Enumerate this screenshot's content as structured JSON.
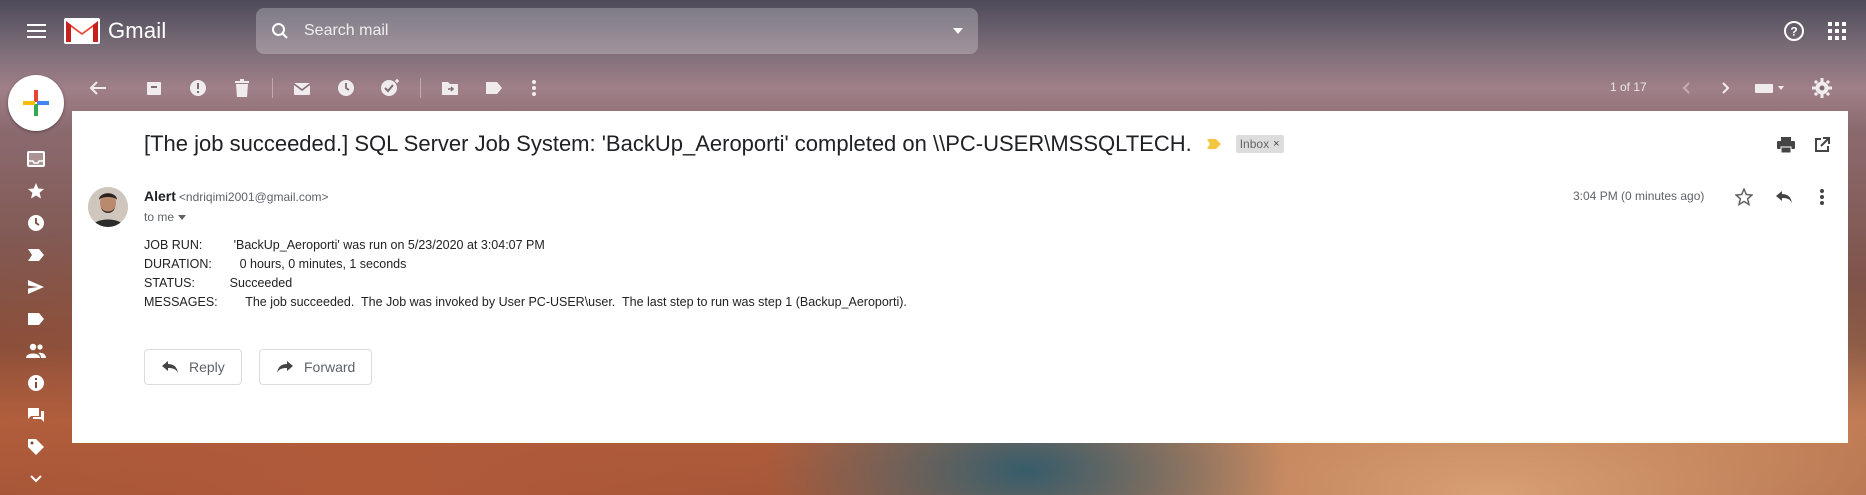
{
  "app": {
    "name": "Gmail"
  },
  "search": {
    "placeholder": "Search mail"
  },
  "toolbar": {
    "pager": "1 of 17"
  },
  "email": {
    "subject": "[The job succeeded.] SQL Server Job System: 'BackUp_Aeroporti' completed on \\\\PC-USER\\MSSQLTECH.",
    "label": "Inbox",
    "label_remove": "×",
    "sender_name": "Alert",
    "sender_email": "<ndriqimi2001@gmail.com>",
    "to": "to me",
    "time": "3:04 PM (0 minutes ago)",
    "body": [
      "JOB RUN:         'BackUp_Aeroporti' was run on 5/23/2020 at 3:04:07 PM",
      "DURATION:        0 hours, 0 minutes, 1 seconds",
      "STATUS:          Succeeded",
      "MESSAGES:        The job succeeded.  The Job was invoked by User PC-USER\\user.  The last step to run was step 1 (Backup_Aeroporti)."
    ]
  },
  "actions": {
    "reply": "Reply",
    "forward": "Forward"
  },
  "colors": {
    "gmail_red": "#ea4335",
    "chip_bg": "#dddddd",
    "important_marker": "#f4c542"
  }
}
